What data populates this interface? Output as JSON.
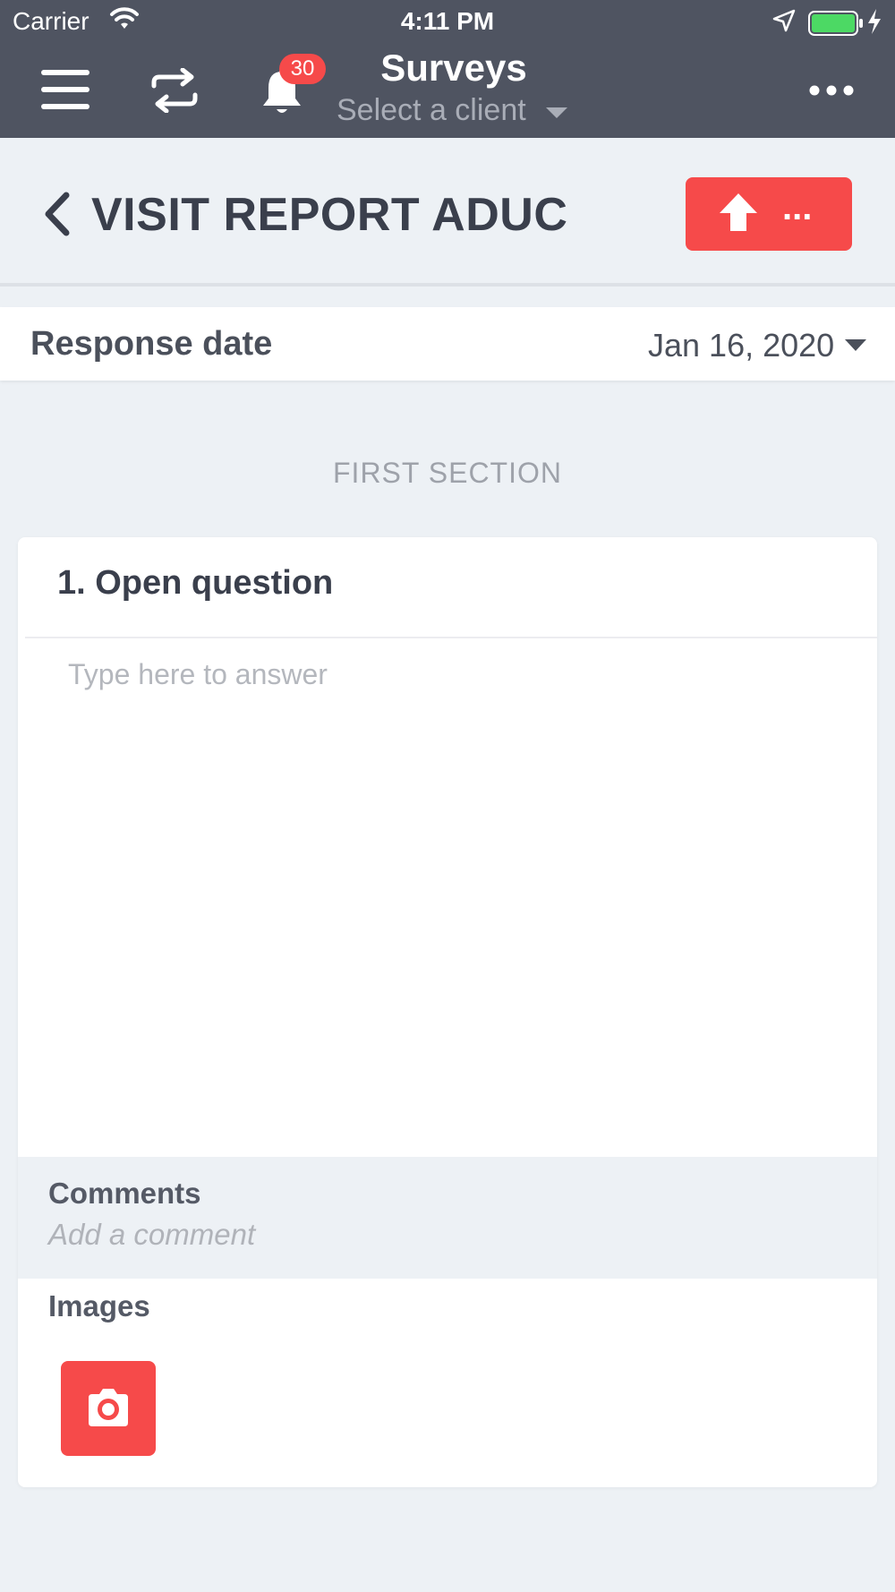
{
  "status_bar": {
    "carrier": "Carrier",
    "time": "4:11 PM",
    "battery_color": "#4cd964"
  },
  "nav": {
    "title": "Surveys",
    "client_placeholder": "Select a client",
    "notification_count": "30",
    "icons": [
      "menu-icon",
      "sync-icon",
      "bell-icon",
      "more-icon"
    ]
  },
  "page": {
    "title": "VISIT REPORT ADUC",
    "upload_label": "...",
    "accent_color": "#f64a4a"
  },
  "response_date": {
    "label": "Response date",
    "value": "Jan 16, 2020"
  },
  "section": {
    "title": "FIRST SECTION"
  },
  "question": {
    "title": "1. Open question",
    "answer_placeholder": "Type here to answer",
    "comments_label": "Comments",
    "comments_placeholder": "Add a comment",
    "images_label": "Images"
  }
}
